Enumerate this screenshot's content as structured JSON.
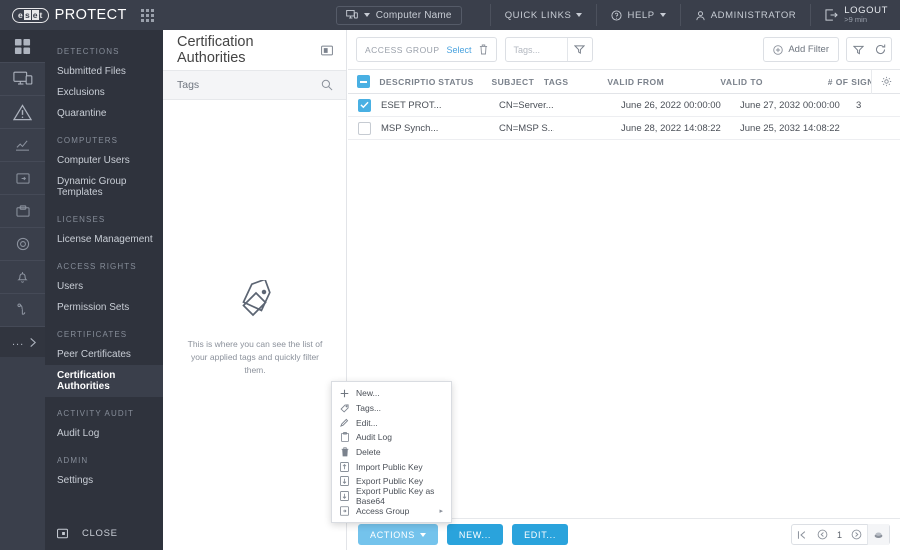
{
  "topbar": {
    "logo_eset": "eset",
    "logo_e": "e",
    "logo_s": "s",
    "logo_e2": "e",
    "logo_t": "t",
    "brand": "PROTECT",
    "apps_icon": "apps-grid-icon",
    "computer_name": "Computer Name",
    "quick_links": "QUICK LINKS",
    "help": "HELP",
    "administrator": "ADMINISTRATOR",
    "logout": "LOGOUT",
    "logout_timer": ">9 min"
  },
  "rail": {
    "items": [
      {
        "name": "dashboard-icon"
      },
      {
        "name": "computers-icon"
      },
      {
        "name": "detections-icon"
      },
      {
        "name": "reports-icon"
      },
      {
        "name": "tasks-icon"
      },
      {
        "name": "installers-icon"
      },
      {
        "name": "policies-icon"
      },
      {
        "name": "notifications-icon"
      },
      {
        "name": "status-overview-icon"
      }
    ],
    "more_label": "..."
  },
  "sidebar": {
    "groups": [
      {
        "header": "DETECTIONS",
        "items": [
          {
            "label": "Submitted Files",
            "active": false
          },
          {
            "label": "Exclusions",
            "active": false
          },
          {
            "label": "Quarantine",
            "active": false
          }
        ]
      },
      {
        "header": "COMPUTERS",
        "items": [
          {
            "label": "Computer Users",
            "active": false
          },
          {
            "label": "Dynamic Group Templates",
            "active": false
          }
        ]
      },
      {
        "header": "LICENSES",
        "items": [
          {
            "label": "License Management",
            "active": false
          }
        ]
      },
      {
        "header": "ACCESS RIGHTS",
        "items": [
          {
            "label": "Users",
            "active": false
          },
          {
            "label": "Permission Sets",
            "active": false
          }
        ]
      },
      {
        "header": "CERTIFICATES",
        "items": [
          {
            "label": "Peer Certificates",
            "active": false
          },
          {
            "label": "Certification Authorities",
            "active": true
          }
        ]
      },
      {
        "header": "ACTIVITY AUDIT",
        "items": [
          {
            "label": "Audit Log",
            "active": false
          }
        ]
      },
      {
        "header": "ADMIN",
        "items": [
          {
            "label": "Settings",
            "active": false
          }
        ]
      }
    ],
    "close_label": "CLOSE",
    "close_icon": "collapse-panel-icon"
  },
  "tags_panel": {
    "page_title": "Certification Authorities",
    "title_icon": "panel-toggle-icon",
    "tags_label": "Tags",
    "search_icon": "search-icon",
    "empty_icon": "tag-icon",
    "empty_text": "This is where you can see the list of your applied tags and quickly filter them."
  },
  "filterbar": {
    "access_group_label": "ACCESS GROUP",
    "access_group_select": "Select",
    "access_group_clear_icon": "trash-icon",
    "tags_placeholder": "Tags...",
    "tags_filter_icon": "funnel-icon",
    "add_filter_label": "Add Filter",
    "add_filter_icon": "plus-circle-icon",
    "filter_icon": "funnel-icon",
    "refresh_icon": "refresh-icon"
  },
  "table": {
    "columns": [
      {
        "label": "DESCRIPTIO",
        "key": "description"
      },
      {
        "label": "STATUS",
        "key": "status"
      },
      {
        "label": "SUBJECT",
        "key": "subject"
      },
      {
        "label": "TAGS",
        "key": "tags"
      },
      {
        "label": "VALID FROM",
        "key": "valid_from"
      },
      {
        "label": "VALID TO",
        "key": "valid_to"
      },
      {
        "label": "# OF SIGNE",
        "key": "num_signed"
      }
    ],
    "settings_icon": "gear-icon",
    "header_checkbox_state": "indeterminate",
    "rows": [
      {
        "selected": true,
        "description": "ESET PROT...",
        "status": "",
        "subject": "CN=Server...",
        "tags": "",
        "valid_from": "June 26, 2022 00:00:00",
        "valid_to": "June 27, 2032 00:00:00",
        "num_signed": "3"
      },
      {
        "selected": false,
        "description": "MSP Synch...",
        "status": "",
        "subject": "CN=MSP S...",
        "tags": "",
        "valid_from": "June 28, 2022 14:08:22",
        "valid_to": "June 25, 2032 14:08:22",
        "num_signed": ""
      }
    ]
  },
  "context_menu": {
    "items": [
      {
        "label": "New...",
        "icon": "plus-icon",
        "submenu": false
      },
      {
        "label": "Tags...",
        "icon": "tag-icon",
        "submenu": false
      },
      {
        "label": "Edit...",
        "icon": "pencil-icon",
        "submenu": false
      },
      {
        "label": "Audit Log",
        "icon": "clipboard-icon",
        "submenu": false
      },
      {
        "label": "Delete",
        "icon": "trash-icon",
        "submenu": false
      },
      {
        "label": "Import Public Key",
        "icon": "import-icon",
        "submenu": false
      },
      {
        "label": "Export Public Key",
        "icon": "export-icon",
        "submenu": false
      },
      {
        "label": "Export Public Key as Base64",
        "icon": "export-icon",
        "submenu": false
      },
      {
        "label": "Access Group",
        "icon": "access-group-icon",
        "submenu": true
      }
    ],
    "submenu_arrow": "▸"
  },
  "bottombar": {
    "actions_label": "ACTIONS",
    "new_label": "NEW...",
    "edit_label": "EDIT...",
    "pager": {
      "first_icon": "first-page-icon",
      "prev_icon": "prev-page-icon",
      "page": "1",
      "next_icon": "next-page-icon",
      "last_icon": "last-page-icon"
    }
  },
  "colors": {
    "dark_header": "#3a3f4b",
    "nav_bg": "#2f333d",
    "accent_blue": "#2aa3dc",
    "accent_light": "#74c3ec",
    "checkbox_blue": "#49b0e3",
    "link_blue": "#4aa3df"
  }
}
